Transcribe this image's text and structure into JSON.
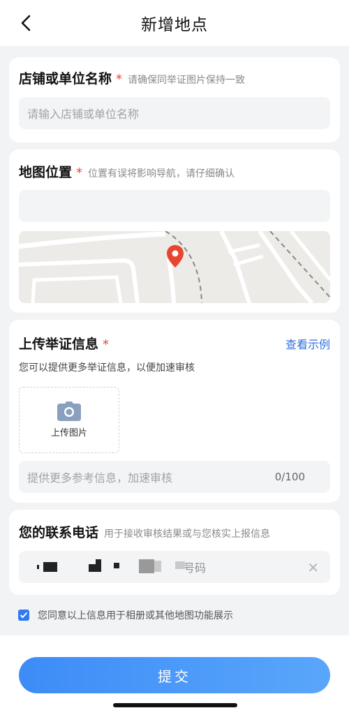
{
  "header": {
    "title": "新增地点"
  },
  "shop": {
    "title": "店铺或单位名称",
    "required": "*",
    "hint": "请确保同举证图片保持一致",
    "placeholder": "请输入店铺或单位名称"
  },
  "location": {
    "title": "地图位置",
    "required": "*",
    "hint": "位置有误将影响导航，请仔细确认",
    "address_value": ""
  },
  "evidence": {
    "title": "上传举证信息",
    "required": "*",
    "example_link": "查看示例",
    "desc": "您可以提供更多举证信息，以便加速审核",
    "upload_label": "上传图片",
    "note_placeholder": "提供更多参考信息，加速审核",
    "counter": "0/100"
  },
  "contact": {
    "title": "您的联系电话",
    "hint": "用于接收审核结果或与您核实上报信息",
    "phone_visible_suffix": "号码"
  },
  "agreement": {
    "checked": true,
    "text": "您同意以上信息用于相册或其他地图功能展示"
  },
  "footer": {
    "submit_label": "提交"
  },
  "colors": {
    "accent": "#2f7bf0",
    "required": "#e8452f",
    "link": "#2f6fe0",
    "pin": "#e8452f"
  },
  "icons": [
    "back-arrow-icon",
    "location-pin-icon",
    "camera-icon",
    "clear-icon",
    "checkmark-icon"
  ]
}
